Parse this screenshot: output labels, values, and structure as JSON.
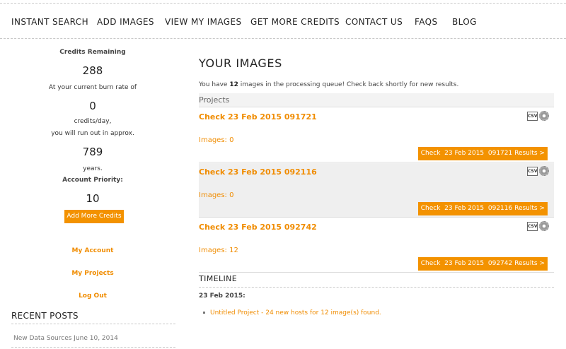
{
  "nav": {
    "items": [
      "INSTANT SEARCH",
      "ADD IMAGES",
      "VIEW MY IMAGES",
      "GET MORE CREDITS",
      "CONTACT US",
      "FAQS",
      "BLOG"
    ]
  },
  "sidebar": {
    "credits_label": "Credits Remaining",
    "credits_value": "288",
    "burn_label": "At your current burn rate of",
    "burn_value": "0",
    "burn_unit": "credits/day,",
    "runout_label": "you will run out in approx.",
    "years_value": "789",
    "years_label": "years.",
    "priority_label": "Account Priority:",
    "priority_value": "10",
    "add_credits_label": "Add More Credits",
    "links": [
      "My Account",
      "My Projects",
      "Log Out"
    ],
    "recent_posts_title": "RECENT POSTS",
    "recent_posts": [
      "New Data Sources June 10, 2014"
    ]
  },
  "main": {
    "title": "YOUR IMAGES",
    "queue_prefix": "You have ",
    "queue_count": "12",
    "queue_suffix": " images in the processing queue! Check back shortly for new results.",
    "projects_header": "Projects",
    "csv_icon_text": "CSV",
    "projects": [
      {
        "title": "Check 23 Feb 2015 091721",
        "images": "Images: 0",
        "results_label": "Check  23 Feb 2015  091721 Results >"
      },
      {
        "title": "Check 23 Feb 2015 092116",
        "images": "Images: 0",
        "results_label": "Check  23 Feb 2015  092116 Results >"
      },
      {
        "title": "Check 23 Feb 2015 092742",
        "images": "Images: 12",
        "results_label": "Check  23 Feb 2015  092742 Results >"
      }
    ],
    "timeline_title": "TIMELINE",
    "timeline_date": "23 Feb 2015:",
    "timeline_entry": "Untitled Project - 24 new hosts for 12 image(s) found."
  },
  "colors": {
    "accent": "#f39200",
    "link": "#f08c00",
    "alt_row": "#efefef"
  }
}
